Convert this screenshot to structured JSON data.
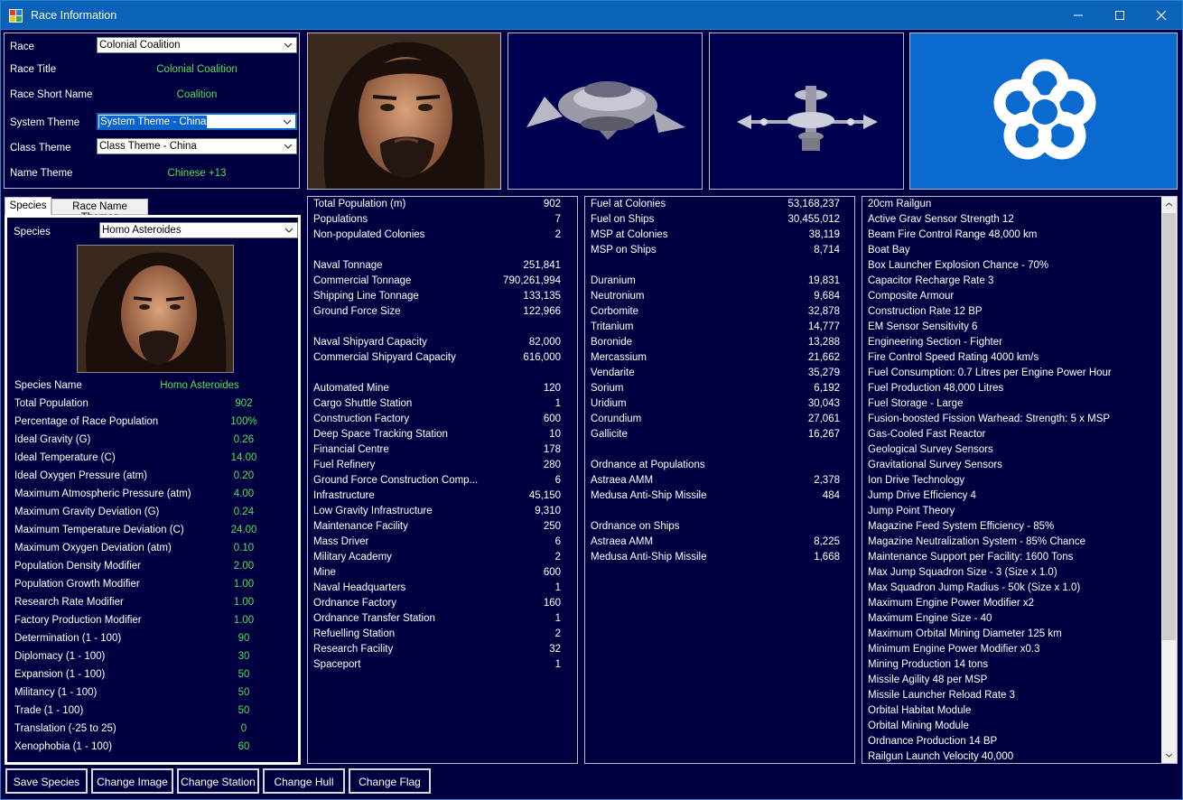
{
  "window": {
    "title": "Race Information"
  },
  "race": {
    "race_label": "Race",
    "race_value": "Colonial Coalition",
    "title_label": "Race Title",
    "title_value": "Colonial Coalition",
    "short_label": "Race Short Name",
    "short_value": "Coalition",
    "system_theme_label": "System Theme",
    "system_theme_value": "System Theme - China",
    "class_theme_label": "Class Theme",
    "class_theme_value": "Class Theme - China",
    "name_theme_label": "Name Theme",
    "name_theme_value": "Chinese +13"
  },
  "tabs": [
    {
      "label": "Species"
    },
    {
      "label": "Race Name Themes"
    }
  ],
  "species": {
    "species_label": "Species",
    "species_value": "Homo Asteroides",
    "rows": [
      {
        "k": "Species Name",
        "v": "Homo Asteroides"
      },
      {
        "k": "Total Population",
        "v": "902"
      },
      {
        "k": "Percentage of Race Population",
        "v": "100%"
      },
      {
        "k": "Ideal Gravity (G)",
        "v": "0.26"
      },
      {
        "k": "Ideal Temperature (C)",
        "v": "14.00"
      },
      {
        "k": "Ideal Oxygen Pressure (atm)",
        "v": "0.20"
      },
      {
        "k": "Maximum Atmospheric Pressure (atm)",
        "v": "4.00"
      },
      {
        "k": "Maximum Gravity Deviation (G)",
        "v": "0.24"
      },
      {
        "k": "Maximum Temperature Deviation (C)",
        "v": "24.00"
      },
      {
        "k": "Maximum Oxygen Deviation (atm)",
        "v": "0.10"
      },
      {
        "k": "Population Density Modifier",
        "v": "2.00"
      },
      {
        "k": "Population Growth Modifier",
        "v": "1.00"
      },
      {
        "k": "Research Rate Modifier",
        "v": "1.00"
      },
      {
        "k": "Factory Production Modifier",
        "v": "1.00"
      },
      {
        "k": "Determination (1 - 100)",
        "v": "90"
      },
      {
        "k": "Diplomacy (1 - 100)",
        "v": "30"
      },
      {
        "k": "Expansion (1 - 100)",
        "v": "50"
      },
      {
        "k": "Militancy (1 - 100)",
        "v": "50"
      },
      {
        "k": "Trade (1 - 100)",
        "v": "50"
      },
      {
        "k": "Translation (-25 to 25)",
        "v": "0"
      },
      {
        "k": "Xenophobia (1 - 100)",
        "v": "60"
      }
    ]
  },
  "summary": [
    {
      "n": "Total Population (m)",
      "c": "902"
    },
    {
      "n": "Populations",
      "c": "7"
    },
    {
      "n": "Non-populated Colonies",
      "c": "2"
    },
    {
      "n": "",
      "c": ""
    },
    {
      "n": "Naval Tonnage",
      "c": "251,841"
    },
    {
      "n": "Commercial Tonnage",
      "c": "790,261,994"
    },
    {
      "n": "Shipping Line Tonnage",
      "c": "133,135"
    },
    {
      "n": "Ground Force Size",
      "c": "122,966"
    },
    {
      "n": "",
      "c": ""
    },
    {
      "n": "Naval Shipyard Capacity",
      "c": "82,000"
    },
    {
      "n": "Commercial Shipyard Capacity",
      "c": "616,000"
    },
    {
      "n": "",
      "c": ""
    },
    {
      "n": "Automated Mine",
      "c": "120"
    },
    {
      "n": "Cargo Shuttle Station",
      "c": "1"
    },
    {
      "n": "Construction Factory",
      "c": "600"
    },
    {
      "n": "Deep Space Tracking Station",
      "c": "10"
    },
    {
      "n": "Financial Centre",
      "c": "178"
    },
    {
      "n": "Fuel Refinery",
      "c": "280"
    },
    {
      "n": "Ground Force Construction Comp...",
      "c": "6"
    },
    {
      "n": "Infrastructure",
      "c": "45,150"
    },
    {
      "n": "Low Gravity Infrastructure",
      "c": "9,310"
    },
    {
      "n": "Maintenance Facility",
      "c": "250"
    },
    {
      "n": "Mass Driver",
      "c": "6"
    },
    {
      "n": "Military Academy",
      "c": "2"
    },
    {
      "n": "Mine",
      "c": "600"
    },
    {
      "n": "Naval Headquarters",
      "c": "1"
    },
    {
      "n": "Ordnance Factory",
      "c": "160"
    },
    {
      "n": "Ordnance Transfer Station",
      "c": "1"
    },
    {
      "n": "Refuelling Station",
      "c": "2"
    },
    {
      "n": "Research Facility",
      "c": "32"
    },
    {
      "n": "Spaceport",
      "c": "1"
    }
  ],
  "resources": [
    {
      "n": "Fuel at Colonies",
      "c": "53,168,237"
    },
    {
      "n": "Fuel on Ships",
      "c": "30,455,012"
    },
    {
      "n": "MSP at Colonies",
      "c": "38,119"
    },
    {
      "n": "MSP on Ships",
      "c": "8,714"
    },
    {
      "n": "",
      "c": ""
    },
    {
      "n": "Duranium",
      "c": "19,831"
    },
    {
      "n": "Neutronium",
      "c": "9,684"
    },
    {
      "n": "Corbomite",
      "c": "32,878"
    },
    {
      "n": "Tritanium",
      "c": "14,777"
    },
    {
      "n": "Boronide",
      "c": "13,288"
    },
    {
      "n": "Mercassium",
      "c": "21,662"
    },
    {
      "n": "Vendarite",
      "c": "35,279"
    },
    {
      "n": "Sorium",
      "c": "6,192"
    },
    {
      "n": "Uridium",
      "c": "30,043"
    },
    {
      "n": "Corundium",
      "c": "27,061"
    },
    {
      "n": "Gallicite",
      "c": "16,267"
    },
    {
      "n": "",
      "c": ""
    },
    {
      "n": "Ordnance at Populations",
      "c": ""
    },
    {
      "n": "Astraea AMM",
      "c": "2,378"
    },
    {
      "n": "Medusa Anti-Ship Missile",
      "c": "484"
    },
    {
      "n": "",
      "c": ""
    },
    {
      "n": "Ordnance on Ships",
      "c": ""
    },
    {
      "n": "Astraea AMM",
      "c": "8,225"
    },
    {
      "n": "Medusa Anti-Ship Missile",
      "c": "1,668"
    }
  ],
  "techs": [
    "20cm Railgun",
    "Active Grav Sensor Strength 12",
    "Beam Fire Control Range 48,000 km",
    "Boat Bay",
    "Box Launcher Explosion Chance - 70%",
    "Capacitor Recharge Rate 3",
    "Composite Armour",
    "Construction Rate 12 BP",
    "EM Sensor Sensitivity 6",
    "Engineering Section - Fighter",
    "Fire Control Speed Rating 4000 km/s",
    "Fuel Consumption: 0.7 Litres per Engine Power Hour",
    "Fuel Production 48,000 Litres",
    "Fuel Storage - Large",
    "Fusion-boosted Fission Warhead: Strength: 5 x MSP",
    "Gas-Cooled Fast Reactor",
    "Geological Survey Sensors",
    "Gravitational Survey Sensors",
    "Ion Drive Technology",
    "Jump Drive Efficiency 4",
    "Jump Point Theory",
    "Magazine Feed System Efficiency - 85%",
    "Magazine Neutralization System - 85% Chance",
    "Maintenance Support per Facility: 1600 Tons",
    "Max Jump Squadron Size - 3 (Size x 1.0)",
    "Max Squadron Jump Radius - 50k (Size x 1.0)",
    "Maximum Engine Power Modifier x2",
    "Maximum Engine Size - 40",
    "Maximum Orbital Mining Diameter 125 km",
    "Minimum Engine Power Modifier x0.3",
    "Mining Production 14 tons",
    "Missile Agility 48 per MSP",
    "Missile Launcher Reload Rate 3",
    "Orbital Habitat Module",
    "Orbital Mining Module",
    "Ordnance Production 14 BP",
    "Railgun Launch Velocity 40,000"
  ],
  "buttons": [
    {
      "label": "Save Species"
    },
    {
      "label": "Change Image"
    },
    {
      "label": "Change Station"
    },
    {
      "label": "Change Hull"
    },
    {
      "label": "Change Flag"
    }
  ],
  "colors": {
    "background": "#000040",
    "titlebar": "#0a63b8",
    "value_green": "#52e052",
    "flag_blue": "#0a6ad0"
  }
}
